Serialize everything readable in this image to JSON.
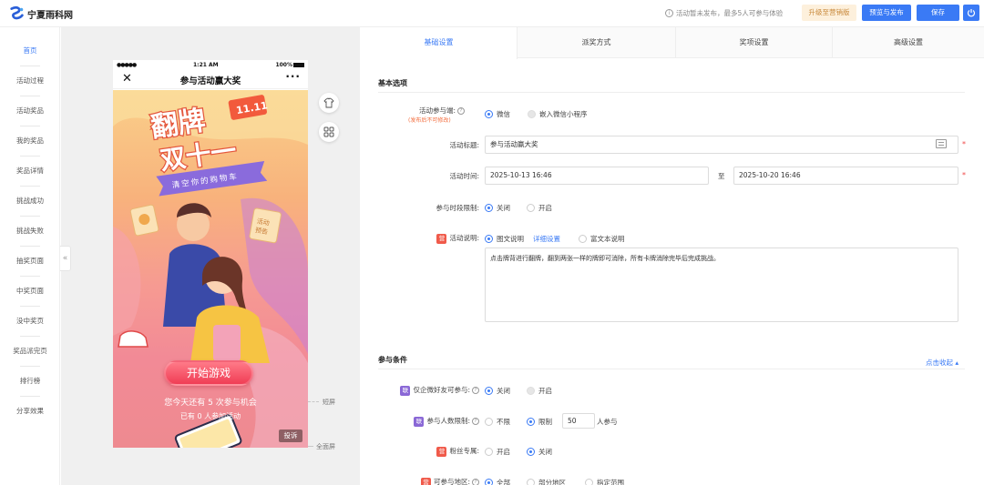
{
  "header": {
    "logo_text": "宁夏雨科网",
    "info_text": "活动暂未发布，最多5人可参与体验",
    "upgrade_label": "升级至营销版",
    "preview_label": "预览与发布",
    "save_label": "保存"
  },
  "leftnav": {
    "items": [
      "首页",
      "活动过程",
      "活动奖品",
      "我的奖品",
      "奖品详情",
      "挑战成功",
      "挑战失败",
      "抽奖页面",
      "中奖页面",
      "没中奖页",
      "奖品派完页",
      "排行榜",
      "分享效果"
    ],
    "collapse_glyph": "«"
  },
  "phone": {
    "time": "1:21 AM",
    "signal": "●●●●●",
    "battery": "100%",
    "title": "参与活动赢大奖",
    "start_button": "开始游戏",
    "remaining_text": "您今天还有 5 次参与机会",
    "joined_text": "已有 0 人参加活动",
    "report_label": "投诉",
    "poster": {
      "headline_1": "翻牌",
      "headline_2": "双十一",
      "tag": "11.11",
      "ribbon": "清空你的购物车",
      "card_text": "活动\n预告"
    }
  },
  "screen_labels": {
    "short": "短屏",
    "full": "全面屏"
  },
  "tabs": [
    "基础设置",
    "派奖方式",
    "奖项设置",
    "高级设置"
  ],
  "basic": {
    "section_title": "基本选项",
    "channel_label": "活动参与端:",
    "channel_hint": "(发布后不可修改)",
    "channel_options": [
      "微信",
      "嵌入微信小程序"
    ],
    "title_label": "活动标题:",
    "title_value": "参与活动赢大奖",
    "time_label": "活动时间:",
    "start_time": "2025-10-13 16:46",
    "to_label": "至",
    "end_time": "2025-10-20 16:46",
    "period_label": "参与时段限制:",
    "period_options": [
      "关闭",
      "开启"
    ],
    "desc_label": "活动说明:",
    "desc_badge": "营",
    "desc_options": [
      "图文说明",
      "富文本说明"
    ],
    "desc_detail_link": "详细设置",
    "desc_text": "点击牌背进行翻牌，翻到两张一样的牌即可消除，所有卡牌消除完毕后完成挑战。"
  },
  "conditions": {
    "section_title": "参与条件",
    "collapse_link": "点击收起",
    "enterprise_label": "仅企微好友可参与:",
    "enterprise_badge": "联",
    "enterprise_options": [
      "关闭",
      "开启"
    ],
    "limit_label": "参与人数限制:",
    "limit_badge": "联",
    "limit_options": [
      "不限",
      "限制"
    ],
    "limit_value": "50",
    "limit_suffix": "人参与",
    "fans_label": "粉丝专属:",
    "fans_badge": "营",
    "fans_options": [
      "开启",
      "关闭"
    ],
    "region_label": "可参与地区:",
    "region_badge": "营",
    "region_options": [
      "全部",
      "部分地区",
      "指定范围"
    ]
  },
  "colors": {
    "accent": "#3a7af5",
    "required": "#f04646",
    "badge_red": "#f05a4a",
    "badge_purple": "#8a68d6"
  }
}
